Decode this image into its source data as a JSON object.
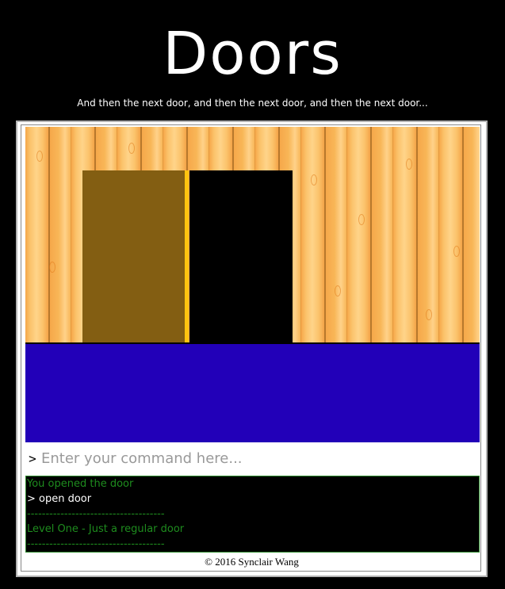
{
  "header": {
    "title": "Doors",
    "subtitle": "And then the next door, and then the next door, and then the next door..."
  },
  "command": {
    "prompt": ">",
    "placeholder": "Enter your command here...",
    "value": ""
  },
  "console": {
    "lines": [
      {
        "text": "You opened the door",
        "color": "green"
      },
      {
        "text": "> open door",
        "color": "white"
      },
      {
        "text": "-------------------------------------",
        "color": "green"
      },
      {
        "text": "Level One - Just a regular door",
        "color": "green"
      },
      {
        "text": "-------------------------------------",
        "color": "green"
      }
    ]
  },
  "footer": {
    "copyright": "© 2016 Synclair Wang"
  },
  "colors": {
    "floor": "#2200b8",
    "door": "#835e12",
    "door_frame_gap": "#ffc30f",
    "doorway": "#000000",
    "console_text": "#1e8c1e"
  }
}
